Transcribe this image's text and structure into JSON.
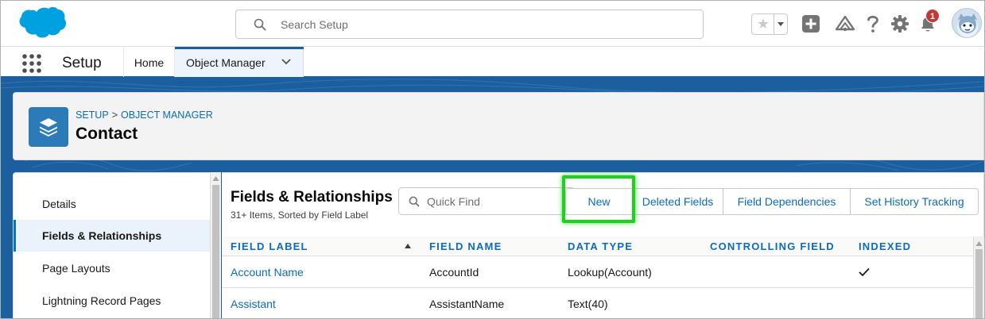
{
  "header": {
    "search_placeholder": "Search Setup",
    "notification_count": "1",
    "icons": [
      "salesforce-logo",
      "search-icon",
      "favorite-star-icon",
      "chevron-down-icon",
      "add-icon",
      "trailhead-icon",
      "help-icon",
      "gear-icon",
      "bell-icon",
      "avatar"
    ]
  },
  "context": {
    "app_name": "Setup",
    "tabs": [
      {
        "label": "Home"
      },
      {
        "label": "Object Manager"
      }
    ]
  },
  "object": {
    "breadcrumb": [
      "SETUP",
      "OBJECT MANAGER"
    ],
    "breadcrumb_sep": ">",
    "title": "Contact"
  },
  "sidebar": {
    "items": [
      {
        "label": "Details"
      },
      {
        "label": "Fields & Relationships"
      },
      {
        "label": "Page Layouts"
      },
      {
        "label": "Lightning Record Pages"
      }
    ]
  },
  "panel": {
    "title": "Fields & Relationships",
    "subtitle": "31+ Items, Sorted by Field Label",
    "quickfind_placeholder": "Quick Find",
    "buttons": {
      "new": "New",
      "deleted": "Deleted Fields",
      "dependencies": "Field Dependencies",
      "history": "Set History Tracking"
    }
  },
  "table": {
    "columns": [
      "FIELD LABEL",
      "FIELD NAME",
      "DATA TYPE",
      "CONTROLLING FIELD",
      "INDEXED"
    ],
    "rows": [
      {
        "label": "Account Name",
        "name": "AccountId",
        "type": "Lookup(Account)",
        "controlling": "",
        "indexed": true
      },
      {
        "label": "Assistant",
        "name": "AssistantName",
        "type": "Text(40)",
        "controlling": "",
        "indexed": false
      }
    ]
  },
  "colors": {
    "brand_blue": "#1b5f9e",
    "link_blue": "#0b6bbf",
    "highlight_green": "#1bd31b",
    "badge_red": "#c23934"
  }
}
